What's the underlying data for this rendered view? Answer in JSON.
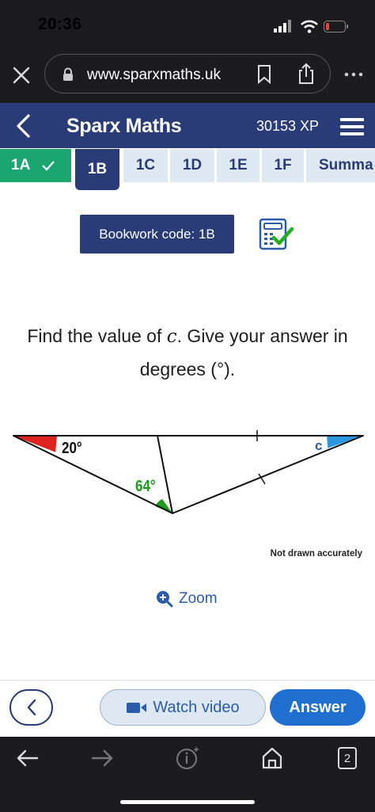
{
  "status_bar": {
    "time": "20:36"
  },
  "browser": {
    "url": "www.sparxmaths.uk",
    "tab_count": "2"
  },
  "app": {
    "title": "Sparx Maths",
    "xp": "30153 XP"
  },
  "tabs": [
    {
      "label": "1A",
      "state": "complete"
    },
    {
      "label": "1B",
      "state": "active"
    },
    {
      "label": "1C",
      "state": "normal"
    },
    {
      "label": "1D",
      "state": "normal"
    },
    {
      "label": "1E",
      "state": "normal"
    },
    {
      "label": "1F",
      "state": "normal"
    },
    {
      "label": "Summa",
      "state": "normal"
    }
  ],
  "bookwork": {
    "label": "Bookwork code: 1B"
  },
  "question": {
    "line1_pre": "Find the value of ",
    "variable": "c",
    "line1_post": ". Give your answer in",
    "line2": "degrees (°)."
  },
  "diagram": {
    "angle_left": "20°",
    "angle_bottom": "64°",
    "angle_right_label": "c",
    "note": "Not drawn accurately"
  },
  "zoom": {
    "label": "Zoom"
  },
  "actions": {
    "watch_video": "Watch video",
    "answer": "Answer"
  },
  "colors": {
    "brand": "#2a3c78",
    "complete": "#1aa571",
    "answer": "#1f6fd1",
    "red_angle": "#e0221f",
    "green_angle": "#1a9a1a",
    "blue_angle": "#2a98e0"
  }
}
